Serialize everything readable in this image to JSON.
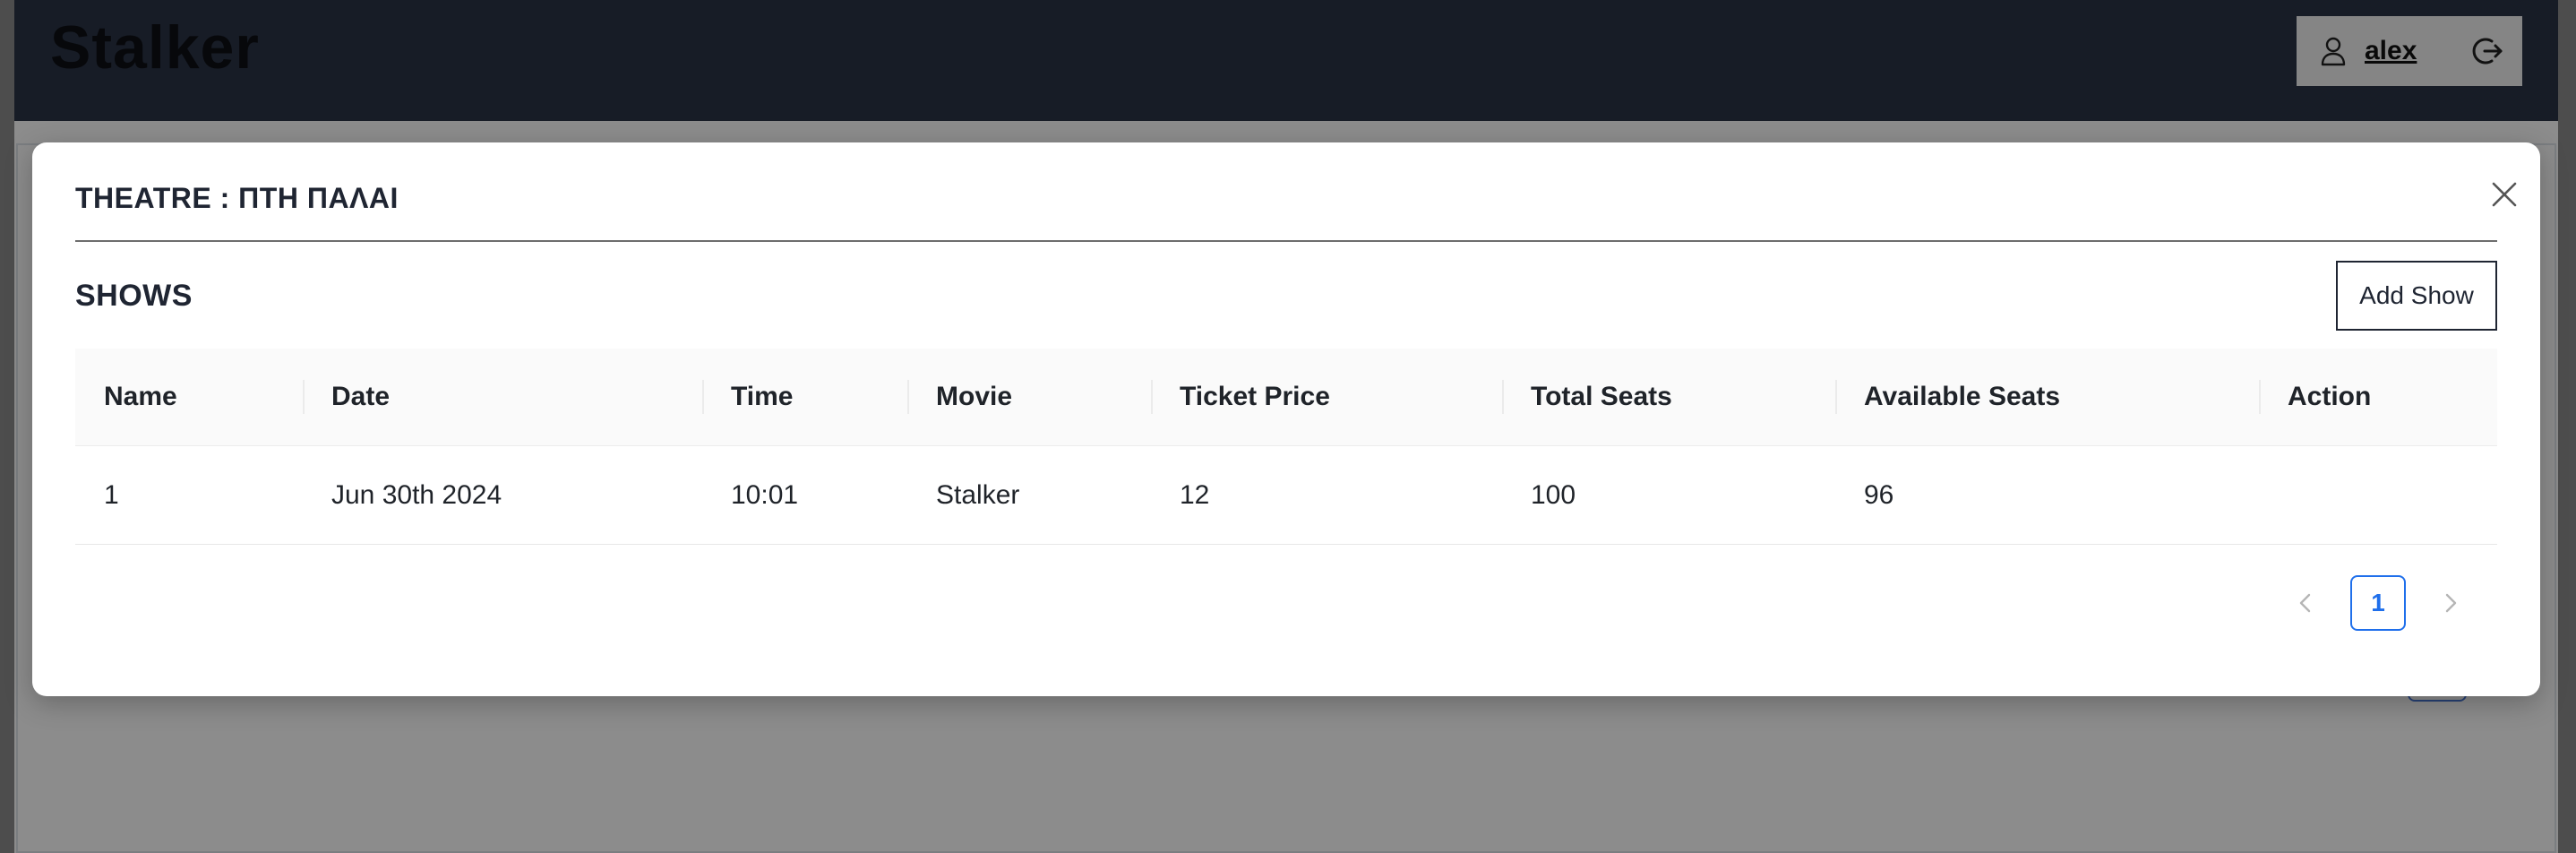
{
  "header": {
    "brand": "Stalker",
    "user": {
      "name": "alex",
      "icon": "user-icon",
      "logout_icon": "logout-icon"
    }
  },
  "modal": {
    "title": "THEATRE : ΠΤΗ ΠΑΛΑΙ",
    "close_icon": "close-icon",
    "section_title": "SHOWS",
    "add_button": "Add Show",
    "table": {
      "columns": [
        "Name",
        "Date",
        "Time",
        "Movie",
        "Ticket Price",
        "Total Seats",
        "Available Seats",
        "Action"
      ],
      "rows": [
        {
          "name": "1",
          "date": "Jun 30th 2024",
          "time": "10:01",
          "movie": "Stalker",
          "ticket_price": "12",
          "total_seats": "100",
          "available_seats": "96",
          "action": ""
        }
      ]
    },
    "pagination": {
      "current_page": "1",
      "prev_icon": "chevron-left-icon",
      "next_icon": "chevron-right-icon"
    }
  },
  "colors": {
    "header_bg": "#2a3345",
    "accent": "#1f6feb",
    "overlay": "#000000"
  }
}
